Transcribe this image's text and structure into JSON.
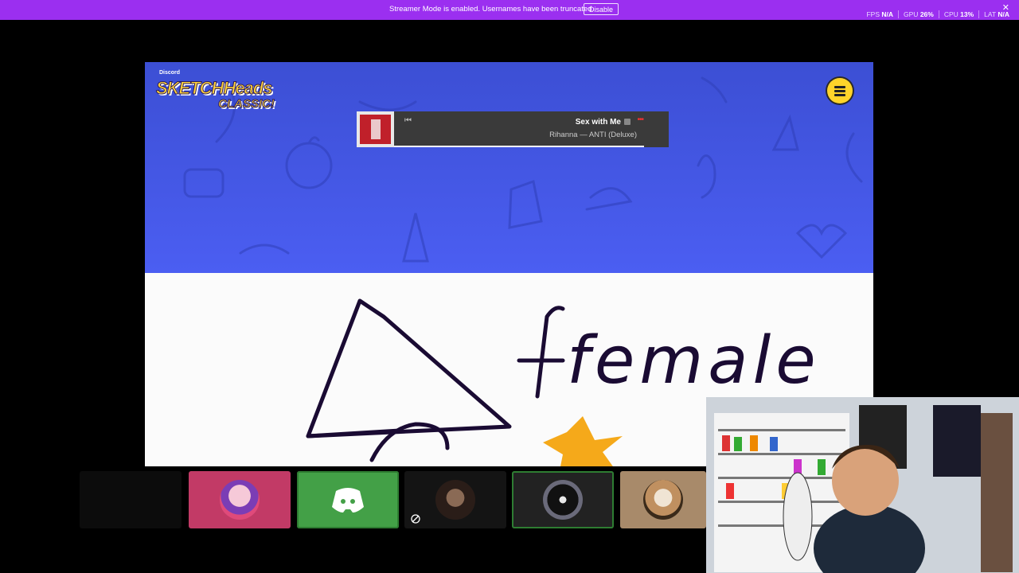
{
  "banner": {
    "message": "Streamer Mode is enabled. Usernames have been truncated.",
    "disable_label": "Disable",
    "stats": [
      {
        "label": "FPS",
        "value": "N/A"
      },
      {
        "label": "GPU",
        "value": "26%"
      },
      {
        "label": "CPU",
        "value": "13%"
      },
      {
        "label": "LAT",
        "value": "N/A"
      }
    ]
  },
  "game": {
    "logo_brand": "Discord",
    "logo_line1": "SKETCHHeads",
    "logo_line2": "CLASSIC!",
    "menu_icon": "hamburger-menu-icon",
    "accent_color": "#4b5ef2",
    "canvas_word": "female"
  },
  "now_playing": {
    "title": "Sex with Me",
    "artist_album": "Rihanna — ANTI (Deluxe)",
    "progress": 1.0
  },
  "participants": [
    {
      "kind": "camera-off",
      "muted": false
    },
    {
      "kind": "avatar",
      "color": "#c23a66"
    },
    {
      "kind": "discord-logo",
      "color": "#43a047",
      "speaking": true
    },
    {
      "kind": "avatar",
      "muted": true
    },
    {
      "kind": "avatar",
      "speaking": true
    },
    {
      "kind": "avatar",
      "color": "#a88a6a"
    }
  ]
}
